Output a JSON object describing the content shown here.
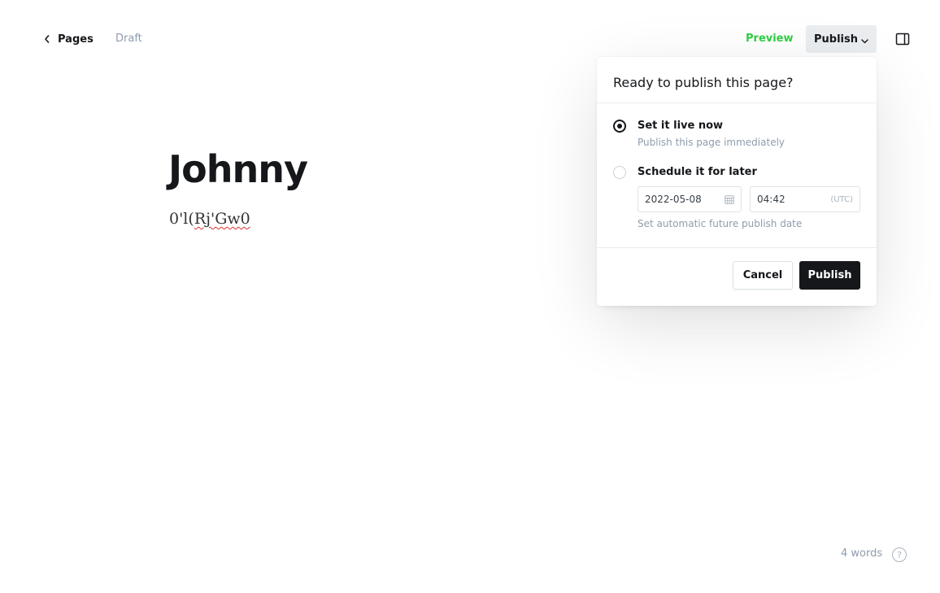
{
  "header": {
    "back_label": "Pages",
    "status": "Draft",
    "preview_label": "Preview",
    "publish_label": "Publish"
  },
  "editor": {
    "title": "Johnny",
    "body_prefix": "0'l(",
    "body_misspelled": "Rj'Gw0"
  },
  "publish_menu": {
    "heading": "Ready to publish this page?",
    "option_now": {
      "label": "Set it live now",
      "description": "Publish this page immediately",
      "selected": true
    },
    "option_later": {
      "label": "Schedule it for later",
      "description": "Set automatic future publish date",
      "selected": false,
      "date": "2022-05-08",
      "time": "04:42",
      "timezone": "(UTC)"
    },
    "cancel_label": "Cancel",
    "confirm_label": "Publish"
  },
  "footer": {
    "word_count": "4 words",
    "help_glyph": "?"
  },
  "colors": {
    "preview_green": "#30cf43",
    "primary_button": "#15171a",
    "muted_text": "#8e9cac"
  },
  "icons": [
    "chevron-left-icon",
    "chevron-down-icon",
    "sidebar-toggle-icon",
    "calendar-icon",
    "help-icon"
  ]
}
